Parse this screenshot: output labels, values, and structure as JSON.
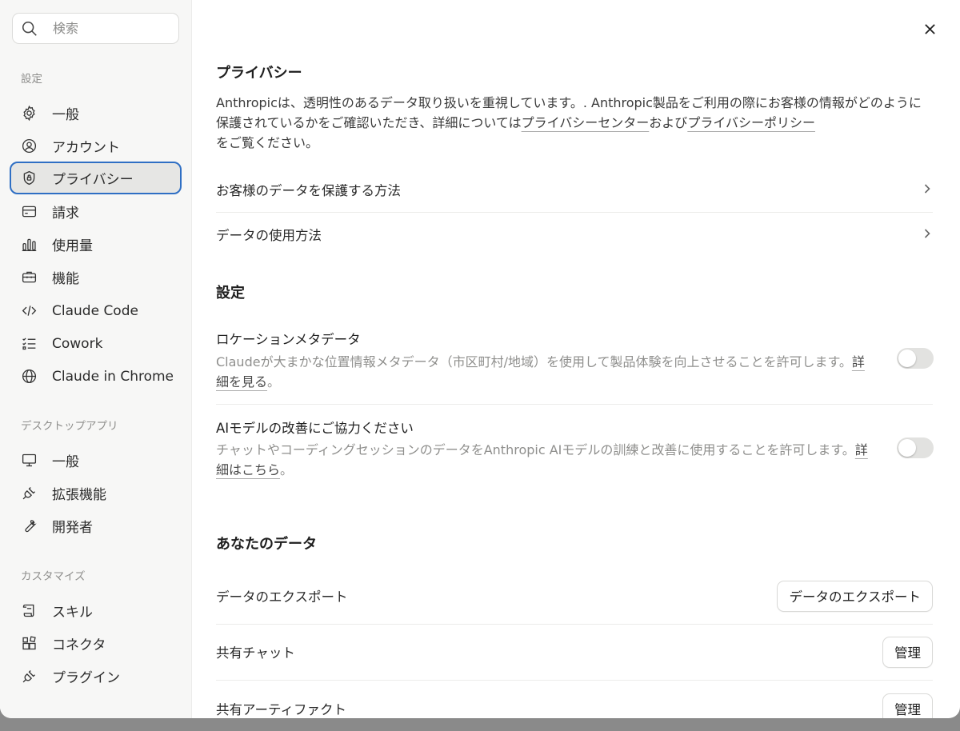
{
  "search": {
    "placeholder": "検索"
  },
  "sidebar": {
    "section_settings": "設定",
    "items": [
      {
        "label": "一般"
      },
      {
        "label": "アカウント"
      },
      {
        "label": "プライバシー"
      },
      {
        "label": "請求"
      },
      {
        "label": "使用量"
      },
      {
        "label": "機能"
      },
      {
        "label": "Claude Code"
      },
      {
        "label": "Cowork"
      },
      {
        "label": "Claude in Chrome"
      }
    ],
    "section_desktop": "デスクトップアプリ",
    "desktop_items": [
      {
        "label": "一般"
      },
      {
        "label": "拡張機能"
      },
      {
        "label": "開発者"
      }
    ],
    "section_customize": "カスタマイズ",
    "customize_items": [
      {
        "label": "スキル"
      },
      {
        "label": "コネクタ"
      },
      {
        "label": "プラグイン"
      }
    ],
    "active_item": "プライバシー"
  },
  "privacy": {
    "title": "プライバシー",
    "intro_1": "Anthropicは、透明性のあるデータ取り扱いを重視しています。. Anthropic製品をご利用の際にお客様の情報がどのように保護されているかをご確認いただき、詳細については",
    "link_center": "プライバシーセンター",
    "intro_and": "および",
    "link_policy": "プライバシーポリシー",
    "intro_end": "をご覧ください。",
    "links": [
      {
        "label": "お客様のデータを保護する方法"
      },
      {
        "label": "データの使用方法"
      }
    ]
  },
  "settings": {
    "title": "設定",
    "location": {
      "title": "ロケーションメタデータ",
      "desc": "Claudeが大まかな位置情報メタデータ（市区町村/地域）を使用して製品体験を向上させることを許可します。",
      "link": "詳細を見る",
      "after": "。",
      "enabled": false
    },
    "training": {
      "title": "AIモデルの改善にご協力ください",
      "desc": "チャットやコーディングセッションのデータをAnthropic AIモデルの訓練と改善に使用することを許可します。",
      "link": "詳細はこちら",
      "after": "。",
      "enabled": false
    }
  },
  "your_data": {
    "title": "あなたのデータ",
    "export": {
      "label": "データのエクスポート",
      "button": "データのエクスポート"
    },
    "shared_chats": {
      "label": "共有チャット",
      "button": "管理"
    },
    "shared_artifacts": {
      "label": "共有アーティファクト",
      "button": "管理"
    }
  },
  "colors": {
    "accent_border": "#2f6fc4",
    "sidebar_bg": "#f7f7f6",
    "active_bg": "#e6e6e4"
  }
}
